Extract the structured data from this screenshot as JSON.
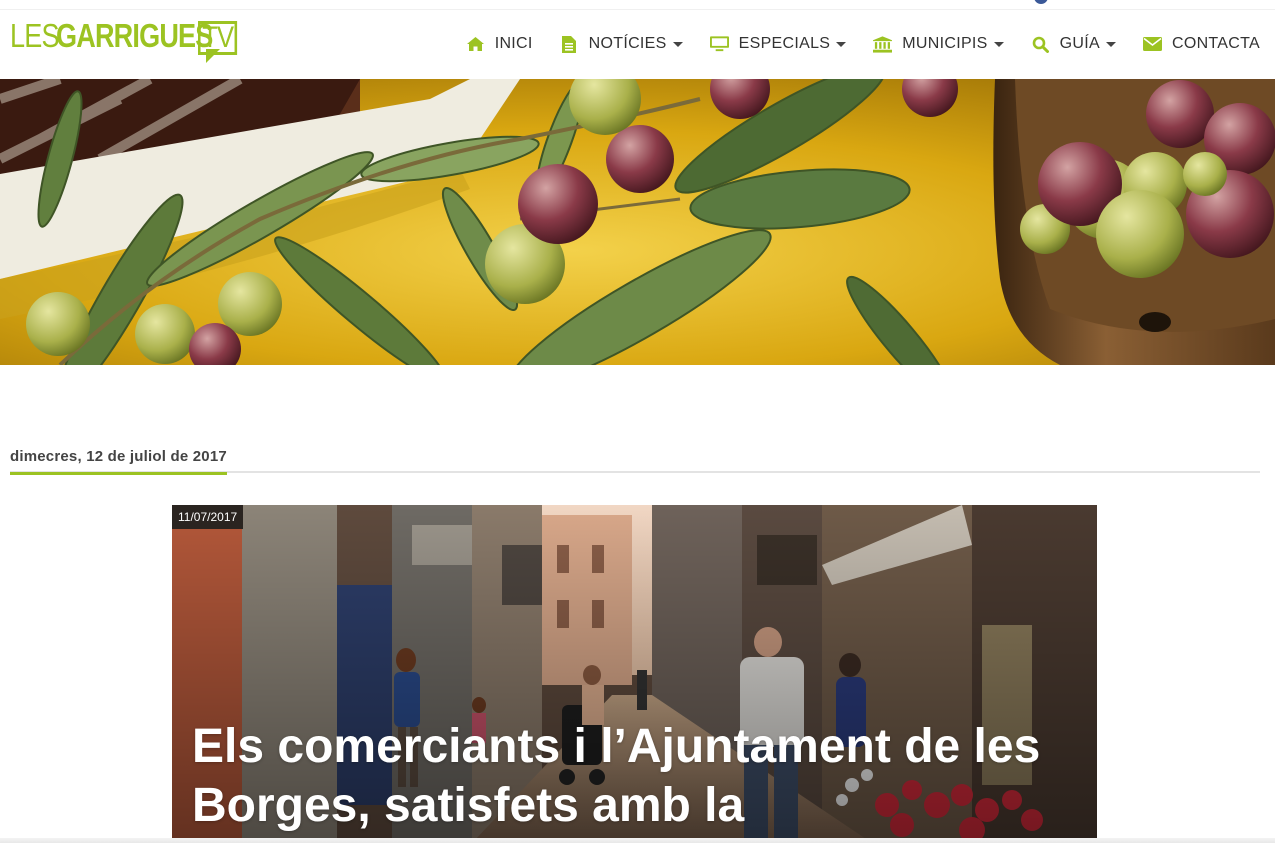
{
  "header": {
    "logo": {
      "les": "LES",
      "garrigues": "GARRIGUES",
      "tv": "TV"
    },
    "nav": [
      {
        "label": "INICI",
        "icon": "home-icon",
        "dropdown": false
      },
      {
        "label": "NOTÍCIES",
        "icon": "document-icon",
        "dropdown": true
      },
      {
        "label": "ESPECIALS",
        "icon": "monitor-icon",
        "dropdown": true
      },
      {
        "label": "MUNICIPIS",
        "icon": "bank-icon",
        "dropdown": true
      },
      {
        "label": "GUÍA",
        "icon": "search-icon",
        "dropdown": true
      },
      {
        "label": "CONTACTA",
        "icon": "envelope-icon",
        "dropdown": false
      }
    ]
  },
  "colors": {
    "accent": "#9cc322",
    "text": "#333333"
  },
  "main": {
    "date_heading": "dimecres, 12 de juliol de 2017",
    "featured": {
      "date": "11/07/2017",
      "title": "Els comerciants i l’Ajuntament de les Borges, satisfets amb la"
    }
  }
}
